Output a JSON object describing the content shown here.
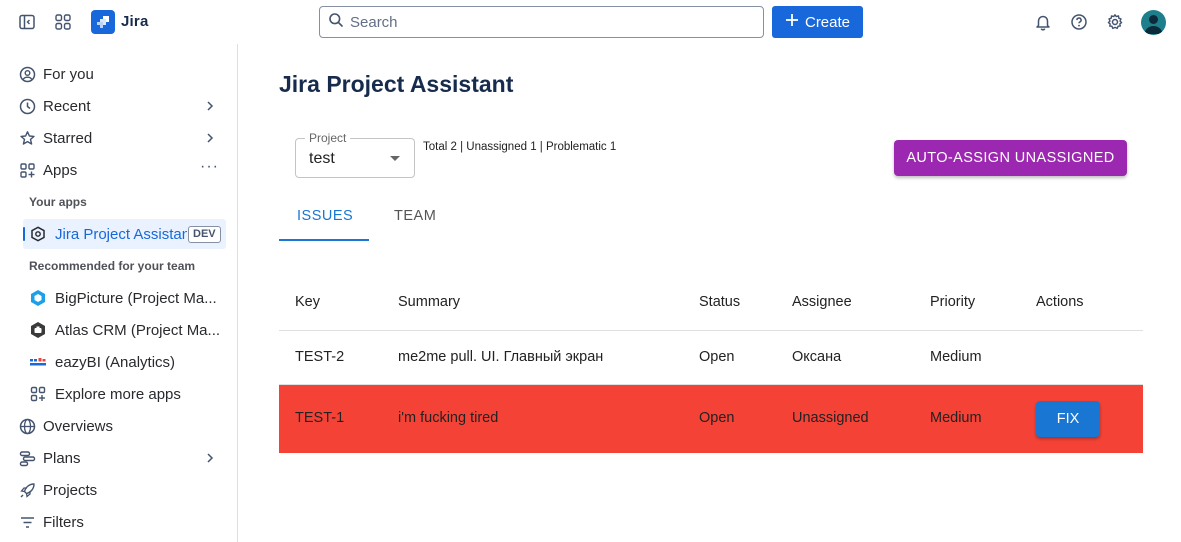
{
  "topbar": {
    "brand": "Jira",
    "search_placeholder": "Search",
    "create_label": "Create"
  },
  "sidebar": {
    "items": [
      {
        "label": "For you",
        "icon": "user-circle-icon"
      },
      {
        "label": "Recent",
        "icon": "clock-icon"
      },
      {
        "label": "Starred",
        "icon": "star-icon"
      },
      {
        "label": "Apps",
        "icon": "apps-icon"
      }
    ],
    "your_apps_label": "Your apps",
    "active_app": {
      "label": "Jira Project Assistant",
      "badge": "DEV"
    },
    "recommended_label": "Recommended for your team",
    "recommended_apps": [
      {
        "label": "BigPicture (Project Ma..."
      },
      {
        "label": "Atlas CRM (Project Ma..."
      },
      {
        "label": "eazyBI (Analytics)"
      },
      {
        "label": "Explore more apps"
      }
    ],
    "bottom_items": [
      {
        "label": "Overviews",
        "icon": "globe-icon"
      },
      {
        "label": "Plans",
        "icon": "plans-icon"
      },
      {
        "label": "Projects",
        "icon": "rocket-icon"
      },
      {
        "label": "Filters",
        "icon": "filter-icon"
      }
    ]
  },
  "main": {
    "title": "Jira Project Assistant",
    "project_select": {
      "label": "Project",
      "value": "test"
    },
    "summary": "Total 2 | Unassigned 1 | Problematic 1",
    "auto_assign_label": "AUTO-ASSIGN UNASSIGNED",
    "tabs": [
      {
        "label": "ISSUES",
        "active": true
      },
      {
        "label": "TEAM",
        "active": false
      }
    ],
    "table": {
      "headers": [
        "Key",
        "Summary",
        "Status",
        "Assignee",
        "Priority",
        "Actions"
      ],
      "rows": [
        {
          "key": "TEST-2",
          "summary": "me2me pull. UI. Главный экран",
          "status": "Open",
          "assignee": "Оксана",
          "priority": "Medium",
          "action": ""
        },
        {
          "key": "TEST-1",
          "summary": "i'm fucking tired",
          "status": "Open",
          "assignee": "Unassigned",
          "priority": "Medium",
          "action": "FIX"
        }
      ]
    }
  },
  "colors": {
    "accent": "#1868db",
    "auto_assign": "#9c27b0",
    "problem_row": "#f44336",
    "tab_active": "#1976d2"
  }
}
